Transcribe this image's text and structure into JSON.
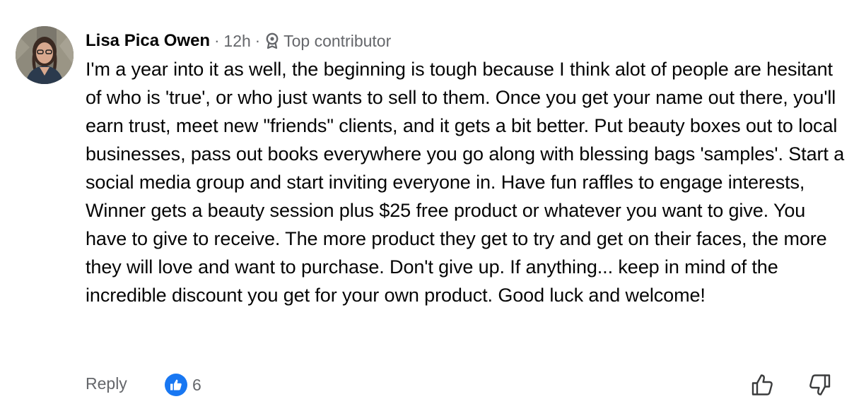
{
  "comment": {
    "author": "Lisa Pica Owen",
    "separator": "·",
    "time": "12h",
    "badge_label": "Top contributor",
    "badge_icon": "award-icon",
    "avatar_icon": "user-avatar",
    "body": "I'm a year into it as well,  the beginning is tough because I think alot of people are hesitant of who is 'true', or who just wants to sell to them. Once you get your name out there, you'll earn trust,  meet new \"friends\" clients,  and it gets a bit better. Put beauty boxes out to local businesses,  pass out books everywhere you go along with blessing bags 'samples'. Start a social media group and start inviting everyone in. Have fun raffles to engage interests, Winner gets a beauty session plus $25 free product or whatever you want to give. You have to give to receive. The more product they get to try and get on their faces, the more they will love and want to purchase. Don't give up. If anything... keep in mind of the incredible discount you get for your own product. Good luck and welcome!"
  },
  "actions": {
    "reply_label": "Reply",
    "like_count": "6",
    "like_icon": "thumbs-up-icon",
    "upvote_icon": "thumbs-up-outline-icon",
    "downvote_icon": "thumbs-down-outline-icon"
  },
  "colors": {
    "accent": "#1877f2",
    "secondary_text": "#65676b",
    "primary_text": "#050505"
  }
}
